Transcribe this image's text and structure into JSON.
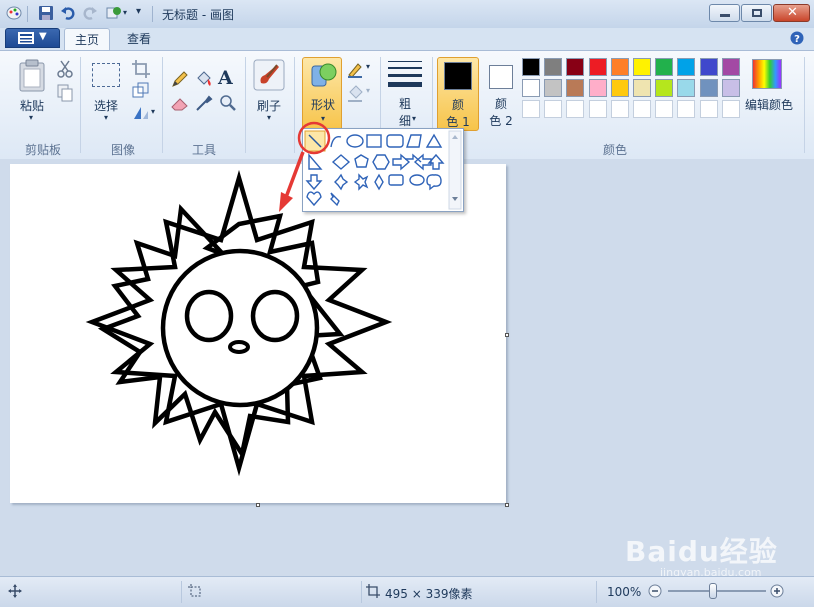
{
  "window": {
    "title": "无标题 - 画图"
  },
  "tabs": [
    {
      "label": "主页"
    },
    {
      "label": "查看"
    }
  ],
  "ribbon": {
    "clipboard": {
      "paste_label": "粘贴",
      "group_label": "剪贴板"
    },
    "image": {
      "select_label": "选择",
      "group_label": "图像"
    },
    "tools": {
      "group_label": "工具"
    },
    "brushes": {
      "label": "刷子"
    },
    "shapes": {
      "label": "形状"
    },
    "size": {
      "label_line1": "粗",
      "label_line2": "细"
    },
    "color1": {
      "label_line1": "颜",
      "label_line2": "色 1",
      "color": "#000000"
    },
    "color2": {
      "label_line1": "颜",
      "label_line2": "色 2",
      "color": "#ffffff"
    },
    "colors": {
      "group_label": "颜色",
      "edit_label": "编辑颜色",
      "palette_row1": [
        "#000000",
        "#7f7f7f",
        "#880015",
        "#ed1c24",
        "#ff7f27",
        "#fff200",
        "#22b14c",
        "#00a2e8",
        "#3f48cc",
        "#a349a4"
      ],
      "palette_row2": [
        "#ffffff",
        "#c3c3c3",
        "#b97a57",
        "#ffaec9",
        "#ffc90e",
        "#efe4b0",
        "#b5e61d",
        "#99d9ea",
        "#7092be",
        "#c8bfe7"
      ]
    }
  },
  "statusbar": {
    "dimensions": "495 × 339像素",
    "zoom": "100%"
  },
  "watermark": {
    "text": "Baidu经验",
    "sub": "jingyan.baidu.com"
  }
}
